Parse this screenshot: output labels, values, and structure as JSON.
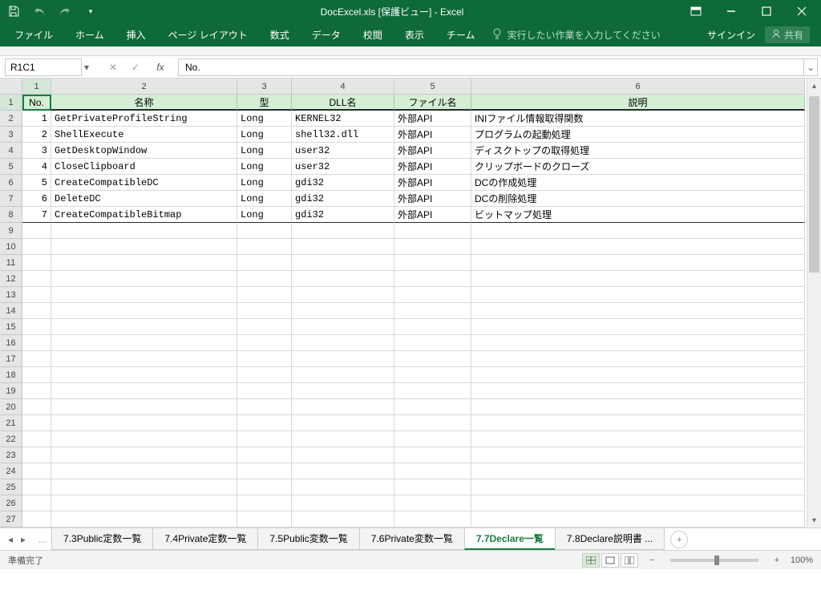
{
  "title": "DocExcel.xls [保護ビュー] - Excel",
  "ribbon": {
    "tabs": [
      "ファイル",
      "ホーム",
      "挿入",
      "ページ レイアウト",
      "数式",
      "データ",
      "校閲",
      "表示",
      "チーム"
    ],
    "tellme": "実行したい作業を入力してください",
    "signin": "サインイン",
    "share": "共有"
  },
  "namebox": "R1C1",
  "formula": "No.",
  "columns": {
    "widths": [
      36,
      232,
      68,
      128,
      96,
      416
    ],
    "labels": [
      "1",
      "2",
      "3",
      "4",
      "5",
      "6"
    ]
  },
  "header_row": [
    "No.",
    "名称",
    "型",
    "DLL名",
    "ファイル名",
    "説明"
  ],
  "rows": [
    {
      "no": "1",
      "name": "GetPrivateProfileString",
      "type": "Long",
      "dll": "KERNEL32",
      "file": "外部API",
      "desc": "INIファイル情報取得関数"
    },
    {
      "no": "2",
      "name": "ShellExecute",
      "type": "Long",
      "dll": "shell32.dll",
      "file": "外部API",
      "desc": "プログラムの起動処理"
    },
    {
      "no": "3",
      "name": "GetDesktopWindow",
      "type": "Long",
      "dll": "user32",
      "file": "外部API",
      "desc": "ディスクトップの取得処理"
    },
    {
      "no": "4",
      "name": "CloseClipboard",
      "type": "Long",
      "dll": "user32",
      "file": "外部API",
      "desc": "クリップボードのクローズ"
    },
    {
      "no": "5",
      "name": "CreateCompatibleDC",
      "type": "Long",
      "dll": "gdi32",
      "file": "外部API",
      "desc": "DCの作成処理"
    },
    {
      "no": "6",
      "name": "DeleteDC",
      "type": "Long",
      "dll": "gdi32",
      "file": "外部API",
      "desc": "DCの削除処理"
    },
    {
      "no": "7",
      "name": "CreateCompatibleBitmap",
      "type": "Long",
      "dll": "gdi32",
      "file": "外部API",
      "desc": "ビットマップ処理"
    }
  ],
  "empty_row_count": 19,
  "row_labels_start": 1,
  "sheet_tabs": [
    "7.3Public定数一覧",
    "7.4Private定数一覧",
    "7.5Public変数一覧",
    "7.6Private変数一覧",
    "7.7Declare一覧",
    "7.8Declare説明書 ..."
  ],
  "active_sheet_index": 4,
  "status": "準備完了",
  "zoom": "100%"
}
